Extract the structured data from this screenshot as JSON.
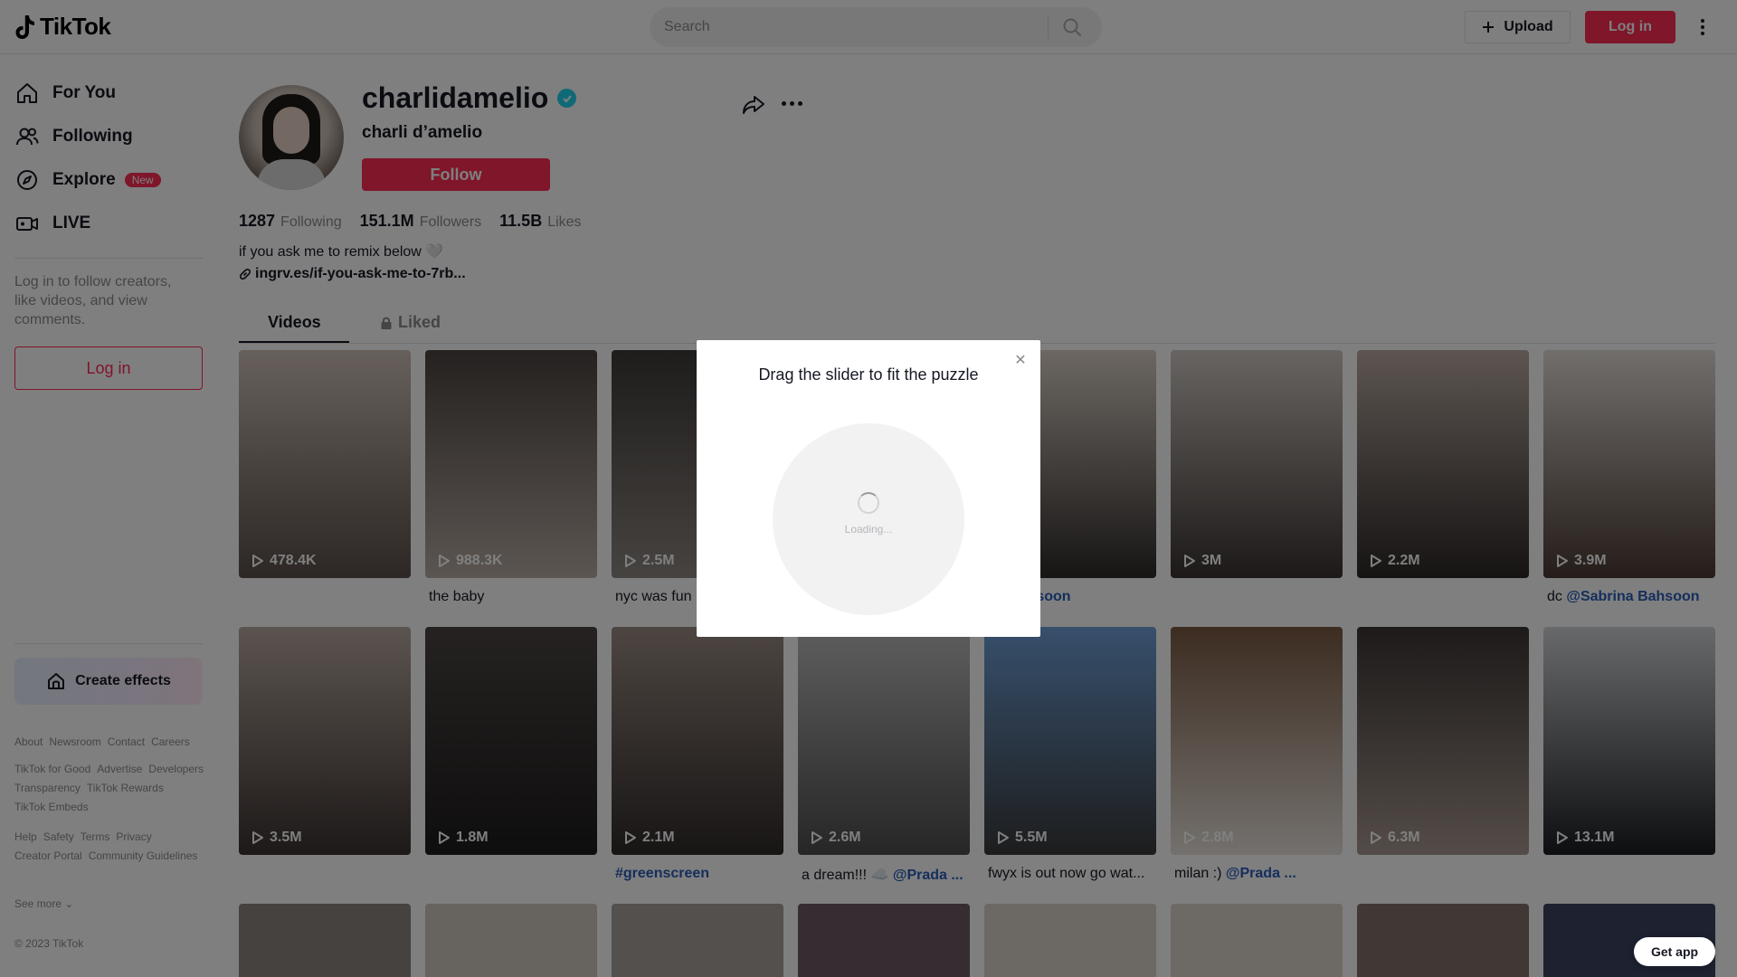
{
  "header": {
    "logo_text": "TikTok",
    "search_placeholder": "Search",
    "upload_label": "Upload",
    "login_label": "Log in"
  },
  "sidebar": {
    "nav": [
      {
        "label": "For You",
        "icon": "home-icon"
      },
      {
        "label": "Following",
        "icon": "following-icon"
      },
      {
        "label": "Explore",
        "icon": "compass-icon",
        "badge": "New"
      },
      {
        "label": "LIVE",
        "icon": "live-icon"
      }
    ],
    "login_prompt": "Log in to follow creators, like videos, and view comments.",
    "login_label": "Log in",
    "create_effects_label": "Create effects",
    "footer_groups": [
      [
        "About",
        "Newsroom",
        "Contact",
        "Careers"
      ],
      [
        "TikTok for Good",
        "Advertise",
        "Developers",
        "Transparency",
        "TikTok Rewards",
        "TikTok Embeds"
      ],
      [
        "Help",
        "Safety",
        "Terms",
        "Privacy",
        "Creator Portal",
        "Community Guidelines"
      ]
    ],
    "see_more": "See more",
    "copyright": "© 2023 TikTok"
  },
  "profile": {
    "username": "charlidamelio",
    "nickname": "charli d’amelio",
    "follow_label": "Follow",
    "following_count": "1287",
    "following_label": "Following",
    "followers_count": "151.1M",
    "followers_label": "Followers",
    "likes_count": "11.5B",
    "likes_label": "Likes",
    "bio": "if you ask me to remix below 🤍",
    "link": "ingrv.es/if-you-ask-me-to-7rb..."
  },
  "tabs": {
    "videos": "Videos",
    "liked": "Liked"
  },
  "videos": [
    {
      "views": "478.4K",
      "caption": "",
      "mention": ""
    },
    {
      "views": "988.3K",
      "caption": "the baby",
      "mention": ""
    },
    {
      "views": "2.5M",
      "caption": "nyc was fun",
      "mention": ""
    },
    {
      "views": "",
      "caption": "",
      "mention": ""
    },
    {
      "views": "M",
      "caption": "",
      "mention": "na Bahsoon"
    },
    {
      "views": "3M",
      "caption": "",
      "mention": ""
    },
    {
      "views": "2.2M",
      "caption": "",
      "mention": ""
    },
    {
      "views": "3.9M",
      "caption": "dc ",
      "mention": "@Sabrina Bahsoon"
    },
    {
      "views": "3.5M",
      "caption": "",
      "mention": ""
    },
    {
      "views": "1.8M",
      "caption": "",
      "mention": ""
    },
    {
      "views": "2.1M",
      "caption": "",
      "mention": "#greenscreen"
    },
    {
      "views": "2.6M",
      "caption": "a dream!!! ☁️ ",
      "mention": "@Prada ..."
    },
    {
      "views": "5.5M",
      "caption": "fwyx is out now go wat...",
      "mention": ""
    },
    {
      "views": "2.8M",
      "caption": "milan :) ",
      "mention": "@Prada ..."
    },
    {
      "views": "6.3M",
      "caption": "",
      "mention": ""
    },
    {
      "views": "13.1M",
      "caption": "",
      "mention": ""
    }
  ],
  "modal": {
    "title": "Drag the slider to fit the puzzle",
    "loading": "Loading..."
  },
  "get_app_label": "Get app"
}
